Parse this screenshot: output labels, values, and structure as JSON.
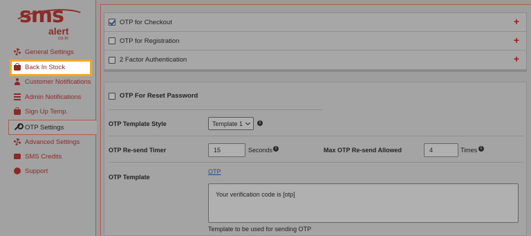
{
  "logo": {
    "brand": "sms",
    "sub": "alert",
    "domain": "co.in"
  },
  "sidebar": {
    "items": [
      {
        "label": "General Settings",
        "icon": "gear-icon"
      },
      {
        "label": "Back In Stock",
        "icon": "bag-icon"
      },
      {
        "label": "Customer Notifications",
        "icon": "user-icon"
      },
      {
        "label": "Admin Notifications",
        "icon": "list-icon"
      },
      {
        "label": "Sign Up Temp.",
        "icon": "bag-icon"
      },
      {
        "label": "OTP Settings",
        "icon": "wrench-icon"
      },
      {
        "label": "Advanced Settings",
        "icon": "gear-icon"
      },
      {
        "label": "SMS Credits",
        "icon": "chat-icon"
      },
      {
        "label": "Support",
        "icon": "help-icon"
      }
    ],
    "highlight_color": "#f5a623"
  },
  "accordion": {
    "rows": [
      {
        "label": "OTP for Checkout",
        "checked": true
      },
      {
        "label": "OTP for Registration",
        "checked": false
      },
      {
        "label": "2 Factor Authentication",
        "checked": false
      }
    ],
    "plus": "+"
  },
  "form": {
    "reset_label": "OTP For Reset Password",
    "template_style_label": "OTP Template Style",
    "template_style_value": "Template 1",
    "resend_timer_label": "OTP Re-send Timer",
    "resend_timer_value": "15",
    "seconds_label": "Seconds",
    "max_resend_label": "Max OTP Re-send Allowed",
    "max_resend_value": "4",
    "times_label": "Times",
    "otp_template_label": "OTP Template",
    "otp_link": "OTP",
    "template_text": "Your verification code is [otp]",
    "template_help": "Template to be used for sending OTP"
  },
  "colors": {
    "accent": "#8b2a26",
    "plus": "#9b1a14",
    "link": "#1b4a8a"
  }
}
